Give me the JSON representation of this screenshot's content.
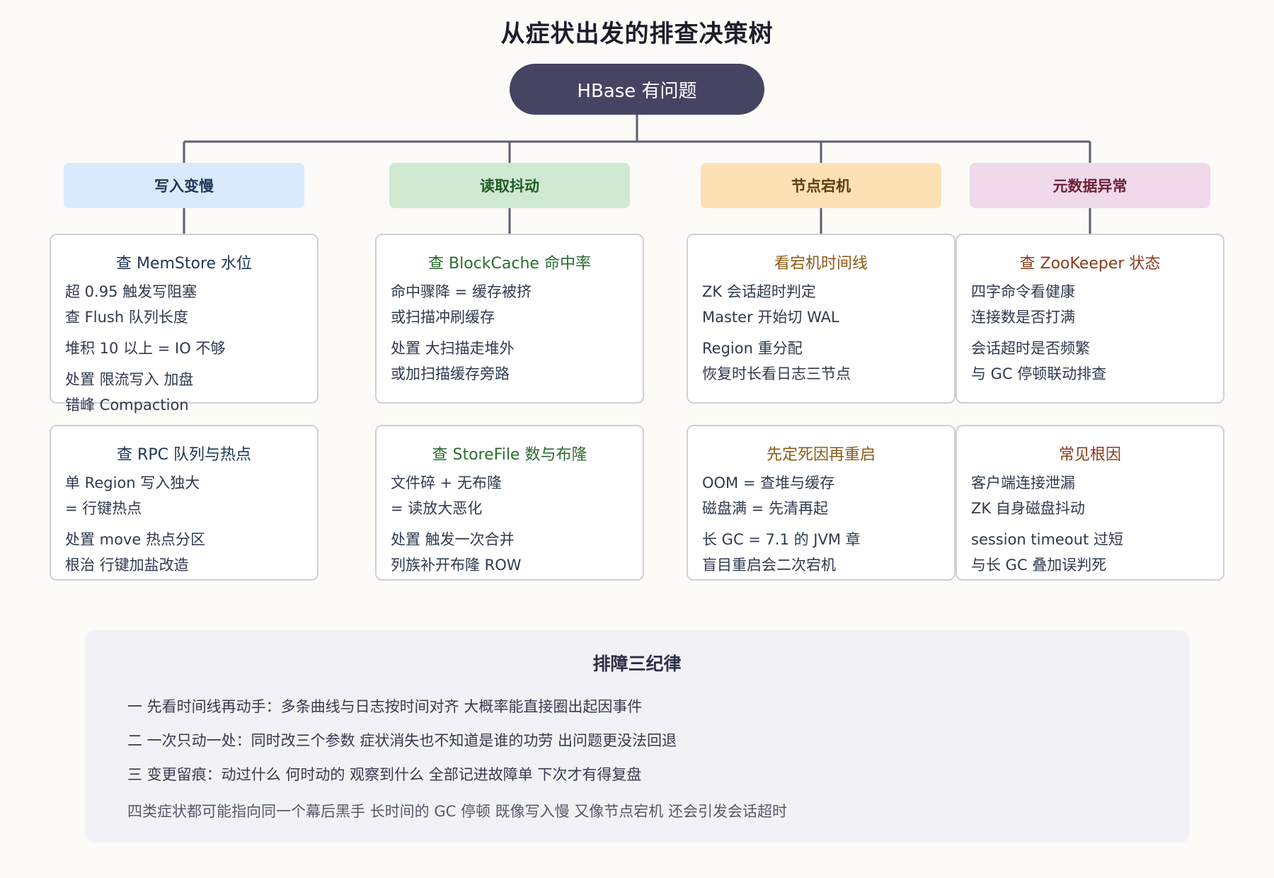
{
  "title": "从症状出发的排查决策树",
  "root": "HBase 有问题",
  "categories": [
    {
      "label": "写入变慢",
      "bg": "#d9eafc",
      "fg": "#1f3654",
      "card_title_color": "#1f3654",
      "cards": [
        {
          "title": "查 MemStore 水位",
          "groups": [
            [
              "超 0.95 触发写阻塞",
              "查 Flush 队列长度"
            ],
            [
              "堆积 10 以上 = IO 不够"
            ],
            [
              "处置 限流写入 加盘",
              "错峰 Compaction"
            ]
          ]
        },
        {
          "title": "查 RPC 队列与热点",
          "groups": [
            [
              "单 Region 写入独大",
              "= 行键热点"
            ],
            [
              "处置 move 热点分区",
              "根治 行键加盐改造"
            ]
          ]
        }
      ]
    },
    {
      "label": "读取抖动",
      "bg": "#d0e9d1",
      "fg": "#1f5a25",
      "card_title_color": "#2b6b2f",
      "cards": [
        {
          "title": "查 BlockCache 命中率",
          "groups": [
            [
              "命中骤降 = 缓存被挤",
              "或扫描冲刷缓存"
            ],
            [
              "处置 大扫描走堆外",
              "或加扫描缓存旁路"
            ]
          ]
        },
        {
          "title": "查 StoreFile 数与布隆",
          "groups": [
            [
              "文件碎 + 无布隆",
              "= 读放大恶化"
            ],
            [
              "处置 触发一次合并",
              "列族补开布隆 ROW"
            ]
          ]
        }
      ]
    },
    {
      "label": "节点宕机",
      "bg": "#fde0b3",
      "fg": "#5e3d0f",
      "card_title_color": "#8a5a16",
      "cards": [
        {
          "title": "看宕机时间线",
          "groups": [
            [
              "ZK 会话超时判定",
              "Master 开始切 WAL"
            ],
            [
              "Region 重分配",
              "恢复时长看日志三节点"
            ]
          ]
        },
        {
          "title": "先定死因再重启",
          "groups": [
            [
              "OOM = 查堆与缓存",
              "磁盘满 = 先清再起"
            ],
            [
              "长 GC = 7.1 的 JVM 章",
              "盲目重启会二次宕机"
            ]
          ]
        }
      ]
    },
    {
      "label": "元数据异常",
      "bg": "#f0d9ea",
      "fg": "#6a1f35",
      "card_title_color": "#8a3b1c",
      "cards": [
        {
          "title": "查 ZooKeeper 状态",
          "groups": [
            [
              "四字命令看健康",
              "连接数是否打满"
            ],
            [
              "会话超时是否频繁",
              "与 GC 停顿联动排查"
            ]
          ]
        },
        {
          "title": "常见根因",
          "groups": [
            [
              "客户端连接泄漏",
              "ZK 自身磁盘抖动"
            ],
            [
              "session timeout 过短",
              "与长 GC 叠加误判死"
            ]
          ]
        }
      ]
    }
  ],
  "summary": {
    "title": "排障三纪律",
    "lines": [
      "一 先看时间线再动手：多条曲线与日志按时间对齐 大概率能直接圈出起因事件",
      "二 一次只动一处：同时改三个参数 症状消失也不知道是谁的功劳 出问题更没法回退",
      "三 变更留痕：动过什么 何时动的 观察到什么 全部记进故障单 下次才有得复盘"
    ],
    "note": "四类症状都可能指向同一个幕后黑手 长时间的 GC 停顿 既像写入慢 又像节点宕机 还会引发会话超时"
  }
}
